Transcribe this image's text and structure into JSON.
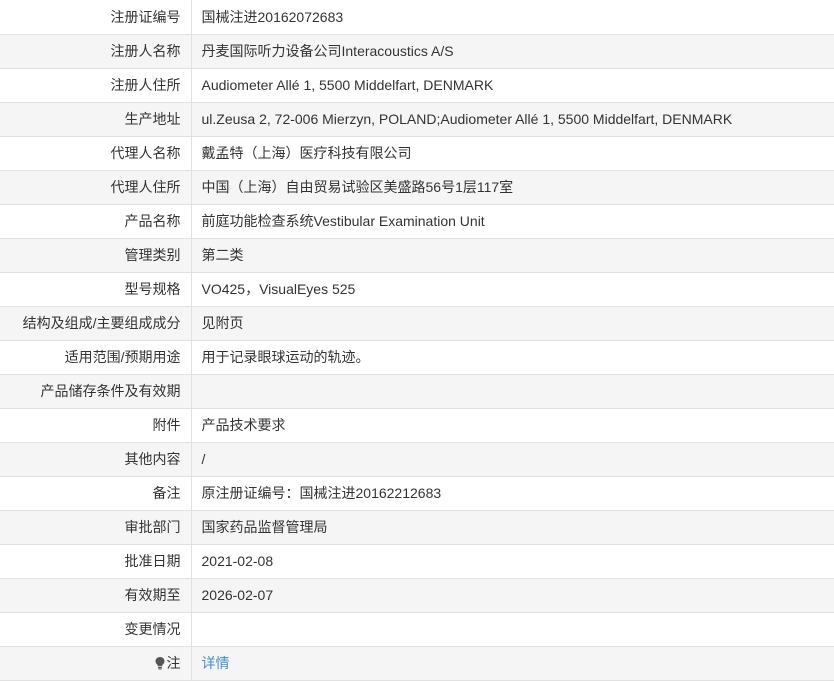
{
  "rows": [
    {
      "label": "注册证编号",
      "value": "国械注进20162072683"
    },
    {
      "label": "注册人名称",
      "value": "丹麦国际听力设备公司Interacoustics A/S"
    },
    {
      "label": "注册人住所",
      "value": "Audiometer Allé 1, 5500 Middelfart, DENMARK"
    },
    {
      "label": "生产地址",
      "value": "ul.Zeusa 2, 72-006 Mierzyn, POLAND;Audiometer Allé 1, 5500 Middelfart, DENMARK"
    },
    {
      "label": "代理人名称",
      "value": "戴孟特（上海）医疗科技有限公司"
    },
    {
      "label": "代理人住所",
      "value": "中国（上海）自由贸易试验区美盛路56号1层117室"
    },
    {
      "label": "产品名称",
      "value": "前庭功能检查系统Vestibular Examination Unit"
    },
    {
      "label": "管理类别",
      "value": "第二类"
    },
    {
      "label": "型号规格",
      "value": "VO425，VisualEyes 525"
    },
    {
      "label": "结构及组成/主要组成成分",
      "value": "见附页"
    },
    {
      "label": "适用范围/预期用途",
      "value": "用于记录眼球运动的轨迹。"
    },
    {
      "label": "产品储存条件及有效期",
      "value": ""
    },
    {
      "label": "附件",
      "value": "产品技术要求"
    },
    {
      "label": "其他内容",
      "value": "/"
    },
    {
      "label": "备注",
      "value": "原注册证编号：国械注进20162212683"
    },
    {
      "label": "审批部门",
      "value": "国家药品监督管理局"
    },
    {
      "label": "批准日期",
      "value": "2021-02-08"
    },
    {
      "label": "有效期至",
      "value": "2026-02-07"
    },
    {
      "label": "变更情况",
      "value": ""
    }
  ],
  "note": {
    "label": "注",
    "icon": "lightbulb-icon",
    "link_text": "详情",
    "link_color": "#3f8fd9"
  }
}
